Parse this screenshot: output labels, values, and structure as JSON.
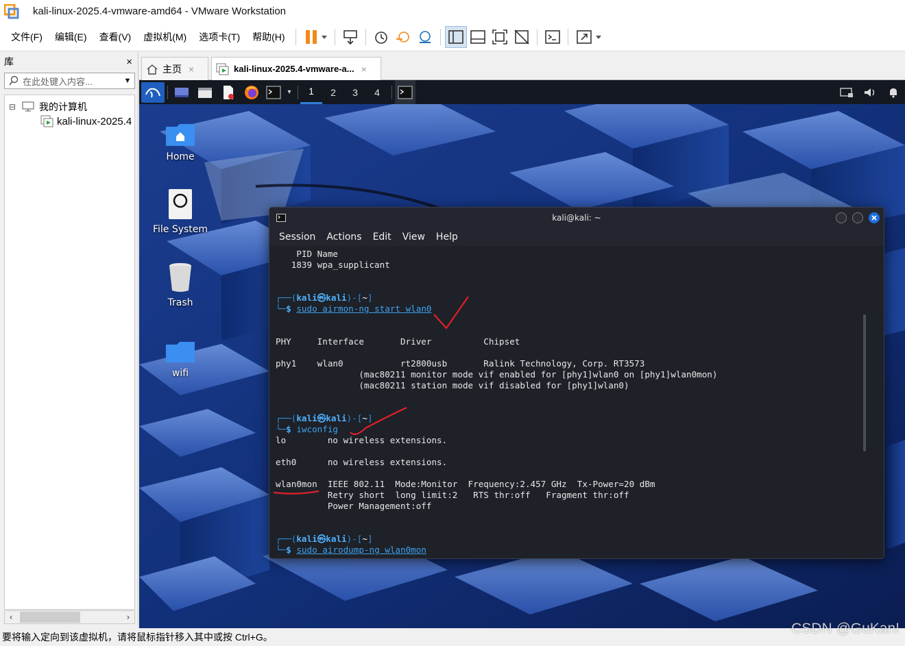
{
  "window": {
    "title": "kali-linux-2025.4-vmware-amd64 - VMware Workstation"
  },
  "menubar": {
    "items": [
      "文件(F)",
      "编辑(E)",
      "查看(V)",
      "虚拟机(M)",
      "选项卡(T)",
      "帮助(H)"
    ]
  },
  "library": {
    "title": "库",
    "close": "×",
    "search_placeholder": "在此处键入内容...",
    "tree": {
      "root_label": "我的计算机",
      "vm_label": "kali-linux-2025.4",
      "expander": "⊟"
    }
  },
  "tabs": [
    {
      "label": "主页",
      "close": "×"
    },
    {
      "label": "kali-linux-2025.4-vmware-a...",
      "close": "×"
    }
  ],
  "kali_panel": {
    "workspaces": [
      "1",
      "2",
      "3",
      "4"
    ]
  },
  "desktop_icons": [
    {
      "label": "Home"
    },
    {
      "label": "File System"
    },
    {
      "label": "Trash"
    },
    {
      "label": "wifi"
    }
  ],
  "terminal": {
    "title": "kali@kali: ~",
    "menu": [
      "Session",
      "Actions",
      "Edit",
      "View",
      "Help"
    ],
    "prompt": {
      "user": "kali",
      "at": "㉿",
      "host": "kali",
      "dir": "~"
    },
    "lines": {
      "l1": "    PID Name",
      "l2": "   1839 wpa_supplicant",
      "cmd1": "sudo airmon-ng start wlan0",
      "hdr": "PHY     Interface       Driver          Chipset",
      "row1": "phy1    wlan0           rt2800usb       Ralink Technology, Corp. RT3573",
      "row2": "                (mac80211 monitor mode vif enabled for [phy1]wlan0 on [phy1]wlan0mon)",
      "row3": "                (mac80211 station mode vif disabled for [phy1]wlan0)",
      "cmd2": "iwconfig",
      "lo": "lo        no wireless extensions.",
      "eth0": "eth0      no wireless extensions.",
      "wlan_a": "wlan0mon  IEEE 802.11  Mode:Monitor  Frequency:2.457 GHz  Tx-Power=20 dBm",
      "wlan_b": "          Retry short  long limit:2   RTS thr:off   Fragment thr:off",
      "wlan_c": "          Power Management:off",
      "cmd3": "sudo airodump-ng wlan0mon"
    }
  },
  "statusbar": {
    "text": "要将输入定向到该虚拟机，请将鼠标指针移入其中或按 Ctrl+G。"
  },
  "watermark": "CSDN @GuKan!",
  "colors": {
    "accent": "#2f8fdf",
    "annotation": "#e0202a",
    "terminal_bg": "#1e2128"
  }
}
